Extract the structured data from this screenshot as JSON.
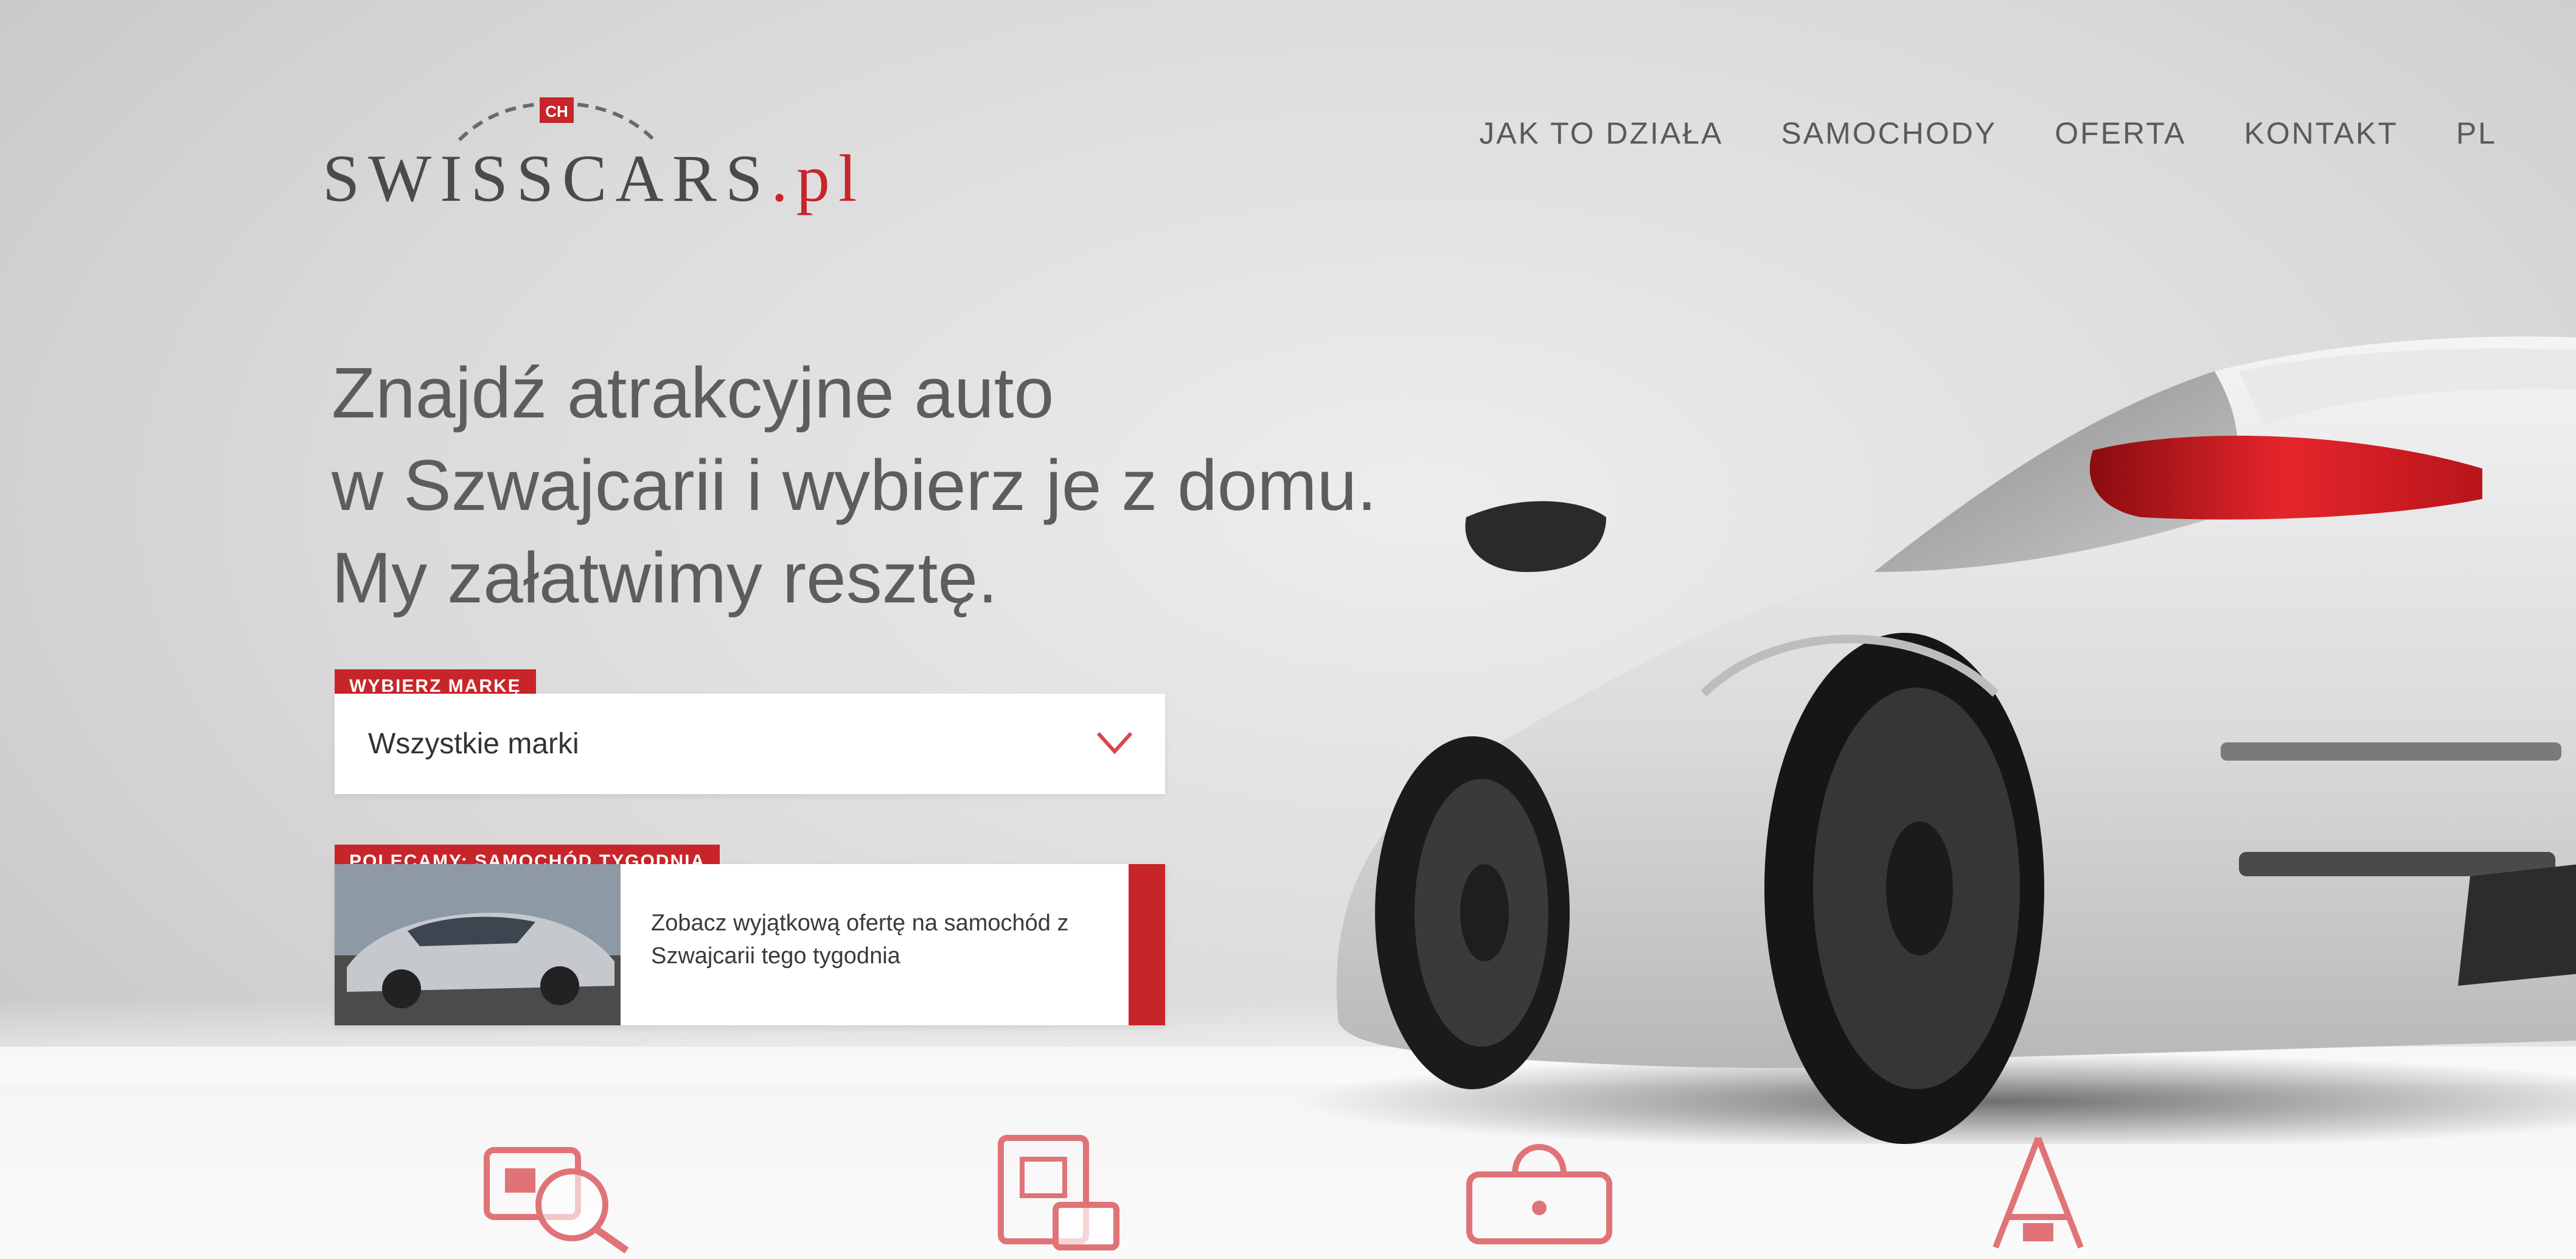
{
  "brand": {
    "name": "SWISSCARS",
    "tld": ".pl",
    "emblem": "CH",
    "accent_color": "#c8252a"
  },
  "nav": {
    "items": [
      {
        "label": "Jak to działa"
      },
      {
        "label": "Samochody"
      },
      {
        "label": "Oferta"
      },
      {
        "label": "Kontakt"
      },
      {
        "label": "PL"
      }
    ]
  },
  "hero": {
    "headline_lines": [
      "Znajdź atrakcyjne auto",
      "w Szwajcarii i wybierz je z domu.",
      "My załatwimy resztę."
    ]
  },
  "search": {
    "tag_label": "Wybierz markę",
    "selected_value": "Wszystkie marki",
    "chevron_icon": "chevron-down-icon"
  },
  "featured": {
    "tag_label": "Polecamy: Samochód tygodnia",
    "description": "Zobacz wyjątkową ofertę na samochód z Szwajcarii tego tygodnia",
    "image_icon": "car-photo"
  },
  "features": [
    {
      "icon": "search-car-icon"
    },
    {
      "icon": "document-icon"
    },
    {
      "icon": "wallet-icon"
    },
    {
      "icon": "user-icon"
    }
  ]
}
